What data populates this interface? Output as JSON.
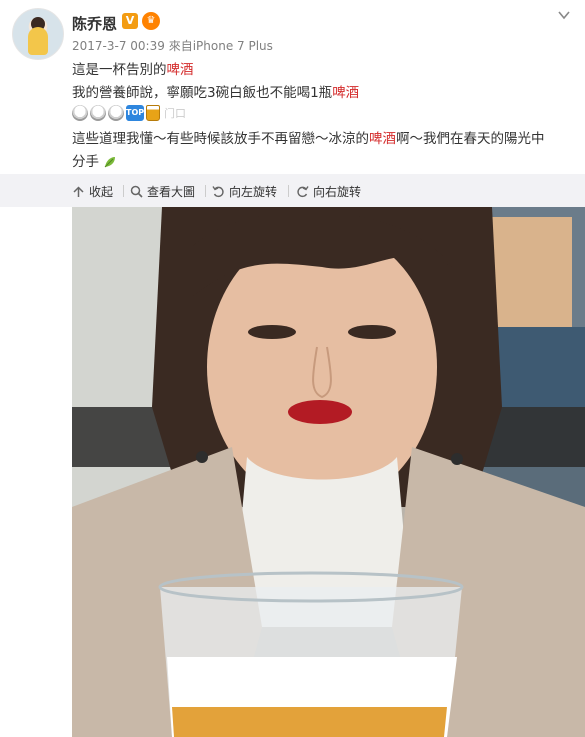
{
  "post": {
    "author": "陈乔恩",
    "verified_badge": "V",
    "member_badge": "♛",
    "time": "2017-3-7 00:39",
    "source_prefix": "來自",
    "source": "iPhone 7 Plus",
    "lines": {
      "l1_a": "這是一杯告別的",
      "l1_hl": "啤酒",
      "l2_a": "我的營養師說，寧願吃3碗白飯也不能喝1瓶",
      "l2_hl": "啤酒",
      "l3_emoji_suffix": "门口",
      "l4_a": "這些道理我懂～有些時候該放手不再留戀～冰涼的",
      "l4_hl": "啤酒",
      "l4_b": "啊～我們在春天的陽光中",
      "l5_a": "分手"
    }
  },
  "toolbar": {
    "collapse": "收起",
    "view_large": "查看大圖",
    "rotate_left": "向左旋转",
    "rotate_right": "向右旋转"
  },
  "colors": {
    "highlight": "#d42b2b",
    "toolbar_bg": "#f2f2f5",
    "meta_text": "#808080"
  },
  "icons": [
    "chevron-down-icon",
    "verified-icon",
    "member-icon",
    "bowl-icon",
    "top-icon",
    "beer-icon",
    "leaf-icon",
    "collapse-icon",
    "zoom-icon",
    "rotate-left-icon",
    "rotate-right-icon"
  ]
}
